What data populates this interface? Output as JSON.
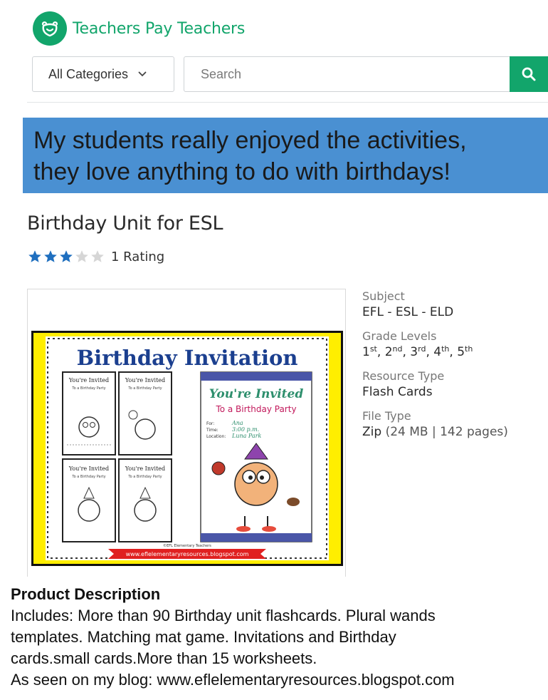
{
  "header": {
    "logo_text": "Teachers Pay Teachers",
    "category_select": "All Categories",
    "search_placeholder": "Search"
  },
  "banner": {
    "line1": "My students really enjoyed the activities,",
    "line2": "they love anything to do with birthdays!"
  },
  "product": {
    "title": "Birthday Unit for ESL",
    "rating": {
      "stars_filled": 3,
      "stars_total": 5,
      "count_label": "1 Rating"
    },
    "preview": {
      "heading": "Birthday Invitation",
      "card_title": "You're Invited",
      "card_subtitle": "To a Birthday Party",
      "small_card_title": "You're Invited",
      "small_card_subtitle": "To a Birthday Party",
      "field_for": "For:",
      "field_time": "Time:",
      "field_location": "Location:",
      "value_for": "Ana",
      "value_time": "3:00 p.m.",
      "value_location": "Luna Park",
      "credit": "©EFL Elementary Teachers",
      "url": "www.eflelementaryresources.blogspot.com"
    },
    "meta": [
      {
        "label": "Subject",
        "value": "EFL - ESL - ELD"
      },
      {
        "label": "Grade Levels",
        "grades": [
          {
            "num": "1",
            "suf": "st"
          },
          {
            "num": "2",
            "suf": "nd"
          },
          {
            "num": "3",
            "suf": "rd"
          },
          {
            "num": "4",
            "suf": "th"
          },
          {
            "num": "5",
            "suf": "th"
          }
        ]
      },
      {
        "label": "Resource Type",
        "value": "Flash Cards"
      },
      {
        "label": "File Type",
        "value": "Zip",
        "detail": " (24 MB | 142 pages)"
      }
    ]
  },
  "description": {
    "title": "Product Description",
    "line1": "Includes: More than 90 Birthday unit flashcards. Plural wands",
    "line2": "templates. Matching mat game. Invitations and Birthday",
    "line3": "cards.small cards.More than 15 worksheets.",
    "line4": "As seen on my blog: www.eflelementaryresources.blogspot.com"
  },
  "colors": {
    "brand_green": "#12a56b",
    "banner_blue": "#4a90d2",
    "star_blue": "#1f6fbf",
    "star_empty": "#d6d6d6",
    "preview_yellow": "#ffee00",
    "preview_title_blue": "#1b3f8f"
  }
}
